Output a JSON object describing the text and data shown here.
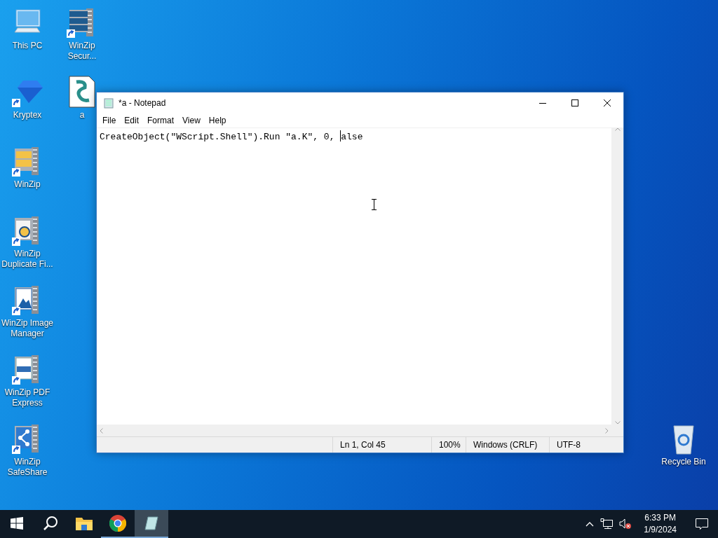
{
  "desktop_icons": [
    {
      "label": "This PC",
      "kind": "computer",
      "shortcut": false
    },
    {
      "label": "Kryptex",
      "kind": "gem",
      "shortcut": true
    },
    {
      "label": "WinZip",
      "kind": "winzip",
      "shortcut": true
    },
    {
      "label": "WinZip Duplicate Fi...",
      "kind": "winzip-search",
      "shortcut": true
    },
    {
      "label": "WinZip Image Manager",
      "kind": "winzip-image",
      "shortcut": true
    },
    {
      "label": "WinZip PDF Express",
      "kind": "winzip-pdf",
      "shortcut": true
    },
    {
      "label": "WinZip SafeShare",
      "kind": "winzip-share",
      "shortcut": true
    },
    {
      "label": "WinZip Secur...",
      "kind": "winzip-server",
      "shortcut": true
    },
    {
      "label": "a",
      "kind": "script",
      "shortcut": false
    }
  ],
  "recycle_bin": {
    "label": "Recycle Bin"
  },
  "window": {
    "title": "*a - Notepad",
    "menu": [
      "File",
      "Edit",
      "Format",
      "View",
      "Help"
    ],
    "editor": {
      "before_caret": "CreateObject(\"WScript.Shell\").Run \"a.K\", 0, ",
      "after_caret": "alse"
    },
    "status_bar": [
      "Ln 1, Col 45",
      "100%",
      "Windows (CRLF)",
      "UTF-8"
    ]
  },
  "taskbar": {
    "items": [
      {
        "kind": "start",
        "selected": false,
        "running": false
      },
      {
        "kind": "search",
        "selected": false,
        "running": false
      },
      {
        "kind": "folder",
        "selected": false,
        "running": false
      },
      {
        "kind": "chrome",
        "selected": false,
        "running": true
      },
      {
        "kind": "notepad",
        "selected": true,
        "running": true
      }
    ],
    "time": "6:33 PM",
    "date": "1/9/2024"
  }
}
